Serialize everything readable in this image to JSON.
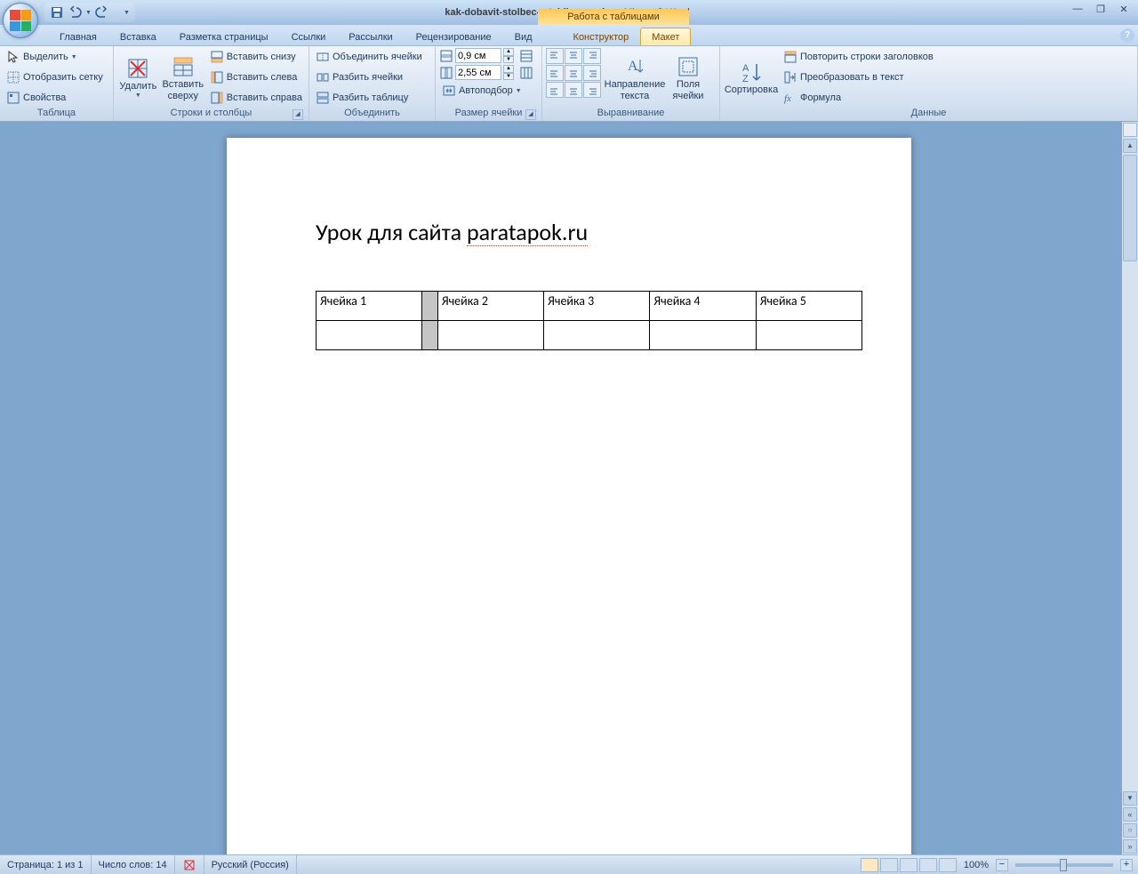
{
  "title": {
    "doc_name": "kak-dobavit-stolbec-v-tablicu-vord",
    "sep": "-",
    "app_name": "Microsoft Word",
    "context_title": "Работа с таблицами"
  },
  "tabs": {
    "home": "Главная",
    "insert": "Вставка",
    "page_layout": "Разметка страницы",
    "references": "Ссылки",
    "mailings": "Рассылки",
    "review": "Рецензирование",
    "view": "Вид",
    "design": "Конструктор",
    "layout": "Макет"
  },
  "ribbon": {
    "table": {
      "label": "Таблица",
      "select": "Выделить",
      "gridlines": "Отобразить сетку",
      "properties": "Свойства"
    },
    "rows_cols": {
      "label": "Строки и столбцы",
      "delete": "Удалить",
      "insert_above": "Вставить\nсверху",
      "insert_below": "Вставить снизу",
      "insert_left": "Вставить слева",
      "insert_right": "Вставить справа"
    },
    "merge": {
      "label": "Объединить",
      "merge_cells": "Объединить ячейки",
      "split_cells": "Разбить ячейки",
      "split_table": "Разбить таблицу"
    },
    "cell_size": {
      "label": "Размер ячейки",
      "height": "0,9 см",
      "width": "2,55 см",
      "autofit": "Автоподбор"
    },
    "alignment": {
      "label": "Выравнивание",
      "text_direction": "Направление\nтекста",
      "cell_margins": "Поля\nячейки"
    },
    "data": {
      "label": "Данные",
      "sort": "Сортировка",
      "repeat_header": "Повторить строки заголовков",
      "convert_text": "Преобразовать в текст",
      "formula": "Формула"
    }
  },
  "document": {
    "heading_plain": "Урок для сайта ",
    "heading_marked": "paratapok.ru",
    "cells": [
      "Ячейка 1",
      "",
      "Ячейка 2",
      "Ячейка 3",
      "Ячейка 4",
      "Ячейка 5"
    ]
  },
  "status": {
    "page": "Страница: 1 из 1",
    "words": "Число слов: 14",
    "language": "Русский (Россия)",
    "zoom": "100%"
  },
  "help": "?"
}
